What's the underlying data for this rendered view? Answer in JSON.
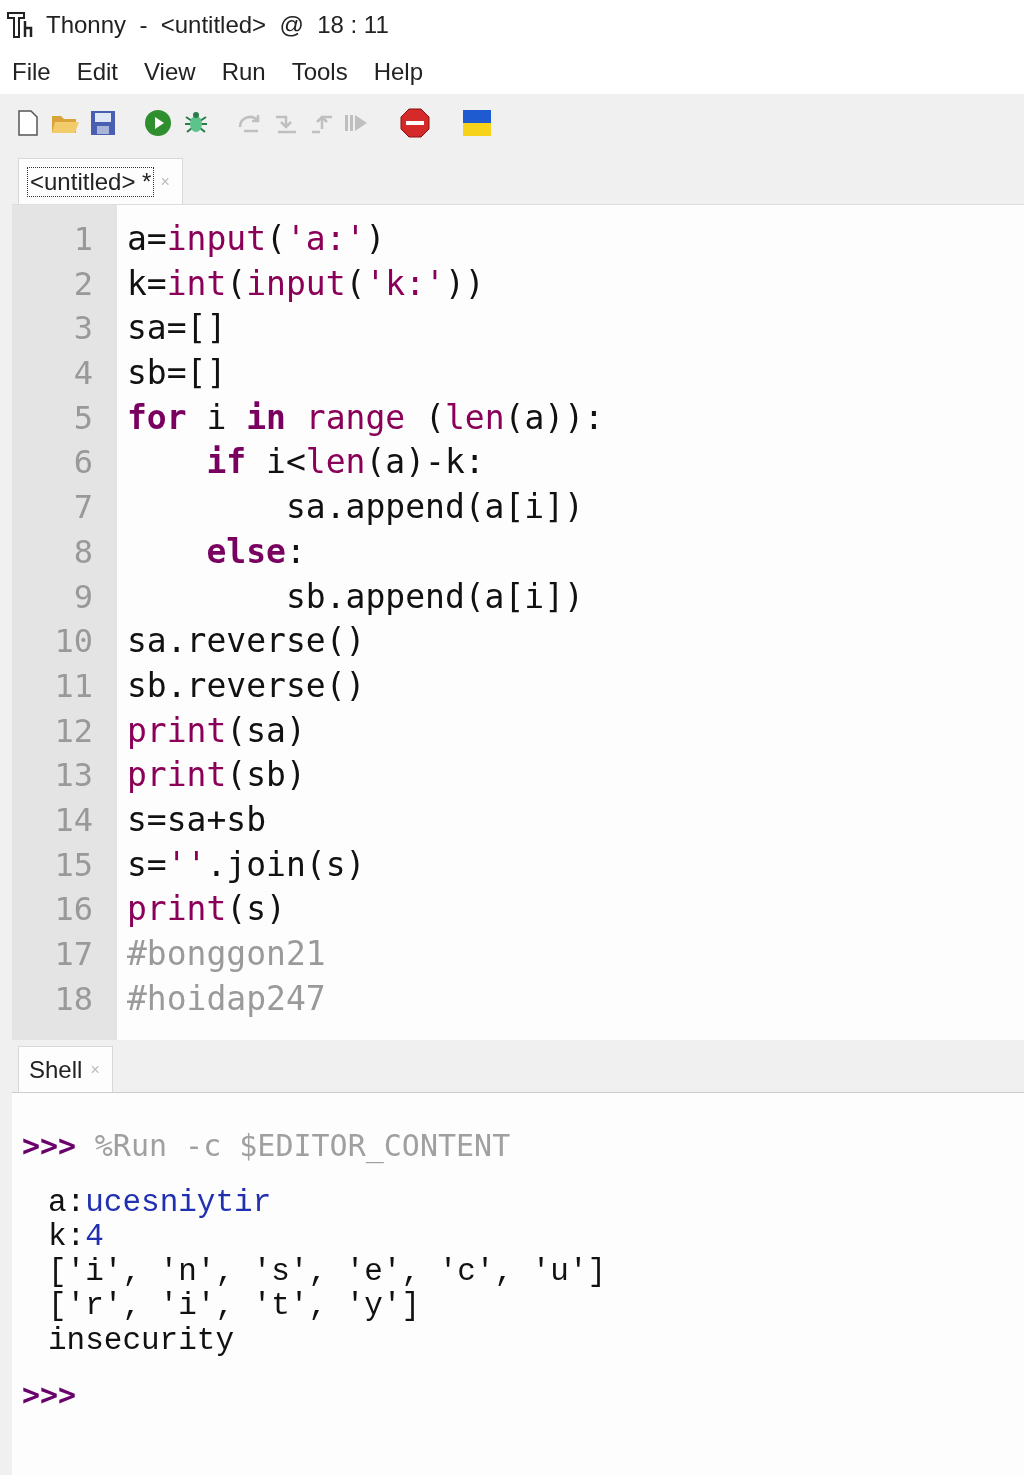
{
  "window": {
    "title": "Thonny  -  <untitled>  @  18 : 11"
  },
  "menu": [
    "File",
    "Edit",
    "View",
    "Run",
    "Tools",
    "Help"
  ],
  "toolbar": [
    {
      "kind": "new",
      "disabled": false
    },
    {
      "kind": "open",
      "disabled": false
    },
    {
      "kind": "save",
      "disabled": false
    },
    {
      "kind": "run",
      "disabled": false
    },
    {
      "kind": "debug",
      "disabled": false
    },
    {
      "kind": "step-over",
      "disabled": true
    },
    {
      "kind": "step-into",
      "disabled": true
    },
    {
      "kind": "step-out",
      "disabled": true
    },
    {
      "kind": "resume",
      "disabled": true
    },
    {
      "kind": "stop",
      "disabled": false
    },
    {
      "kind": "flag",
      "disabled": false
    }
  ],
  "editor_tabs": [
    {
      "label": "<untitled> *",
      "close": "×",
      "selected": true
    }
  ],
  "editor": {
    "lines": [
      {
        "number": "1",
        "tokens": [
          {
            "kind": "plain",
            "text": "a="
          },
          {
            "kind": "builtin",
            "text": "input"
          },
          {
            "kind": "plain",
            "text": "("
          },
          {
            "kind": "string",
            "text": "'a:'"
          },
          {
            "kind": "plain",
            "text": ")"
          }
        ]
      },
      {
        "number": "2",
        "tokens": [
          {
            "kind": "plain",
            "text": "k="
          },
          {
            "kind": "builtin",
            "text": "int"
          },
          {
            "kind": "plain",
            "text": "("
          },
          {
            "kind": "builtin",
            "text": "input"
          },
          {
            "kind": "plain",
            "text": "("
          },
          {
            "kind": "string",
            "text": "'k:'"
          },
          {
            "kind": "plain",
            "text": "))"
          }
        ]
      },
      {
        "number": "3",
        "tokens": [
          {
            "kind": "plain",
            "text": "sa=[]"
          }
        ]
      },
      {
        "number": "4",
        "tokens": [
          {
            "kind": "plain",
            "text": "sb=[]"
          }
        ]
      },
      {
        "number": "5",
        "tokens": [
          {
            "kind": "keyword",
            "text": "for"
          },
          {
            "kind": "plain",
            "text": " i "
          },
          {
            "kind": "keyword",
            "text": "in"
          },
          {
            "kind": "builtin",
            "text": " range"
          },
          {
            "kind": "plain",
            "text": " ("
          },
          {
            "kind": "builtin",
            "text": "len"
          },
          {
            "kind": "plain",
            "text": "(a)):"
          }
        ]
      },
      {
        "number": "6",
        "tokens": [
          {
            "kind": "keyword",
            "text": "    if"
          },
          {
            "kind": "plain",
            "text": " i<"
          },
          {
            "kind": "builtin",
            "text": "len"
          },
          {
            "kind": "plain",
            "text": "(a)-k:"
          }
        ]
      },
      {
        "number": "7",
        "tokens": [
          {
            "kind": "plain",
            "text": "        sa.append(a[i])"
          }
        ]
      },
      {
        "number": "8",
        "tokens": [
          {
            "kind": "keyword",
            "text": "    else"
          },
          {
            "kind": "plain",
            "text": ":"
          }
        ]
      },
      {
        "number": "9",
        "tokens": [
          {
            "kind": "plain",
            "text": "        sb.append(a[i])"
          }
        ]
      },
      {
        "number": "10",
        "tokens": [
          {
            "kind": "plain",
            "text": "sa.reverse()"
          }
        ]
      },
      {
        "number": "11",
        "tokens": [
          {
            "kind": "plain",
            "text": "sb.reverse()"
          }
        ]
      },
      {
        "number": "12",
        "tokens": [
          {
            "kind": "builtin",
            "text": "print"
          },
          {
            "kind": "plain",
            "text": "(sa)"
          }
        ]
      },
      {
        "number": "13",
        "tokens": [
          {
            "kind": "builtin",
            "text": "print"
          },
          {
            "kind": "plain",
            "text": "(sb)"
          }
        ]
      },
      {
        "number": "14",
        "tokens": [
          {
            "kind": "plain",
            "text": "s=sa+sb"
          }
        ]
      },
      {
        "number": "15",
        "tokens": [
          {
            "kind": "plain",
            "text": "s="
          },
          {
            "kind": "string",
            "text": "''"
          },
          {
            "kind": "plain",
            "text": ".join(s)"
          }
        ]
      },
      {
        "number": "16",
        "tokens": [
          {
            "kind": "builtin",
            "text": "print"
          },
          {
            "kind": "plain",
            "text": "(s)"
          }
        ]
      },
      {
        "number": "17",
        "tokens": [
          {
            "kind": "comment",
            "text": "#bonggon21"
          }
        ]
      },
      {
        "number": "18",
        "tokens": [
          {
            "kind": "comment",
            "text": "#hoidap247"
          }
        ]
      }
    ]
  },
  "shell_tab": {
    "label": "Shell",
    "close": "×",
    "selected": true
  },
  "shell": [
    {
      "kind": "command",
      "prompt": ">>>",
      "text": "%Run -c $EDITOR_CONTENT"
    },
    {
      "kind": "input",
      "label": "a:",
      "value": "ucesniytir"
    },
    {
      "kind": "input",
      "label": "k:",
      "value": "4"
    },
    {
      "kind": "output",
      "text": "['i', 'n', 's', 'e', 'c', 'u']"
    },
    {
      "kind": "output",
      "text": "['r', 'i', 't', 'y']"
    },
    {
      "kind": "output",
      "text": "insecurity"
    },
    {
      "kind": "prompt",
      "prompt": ">>>"
    }
  ]
}
